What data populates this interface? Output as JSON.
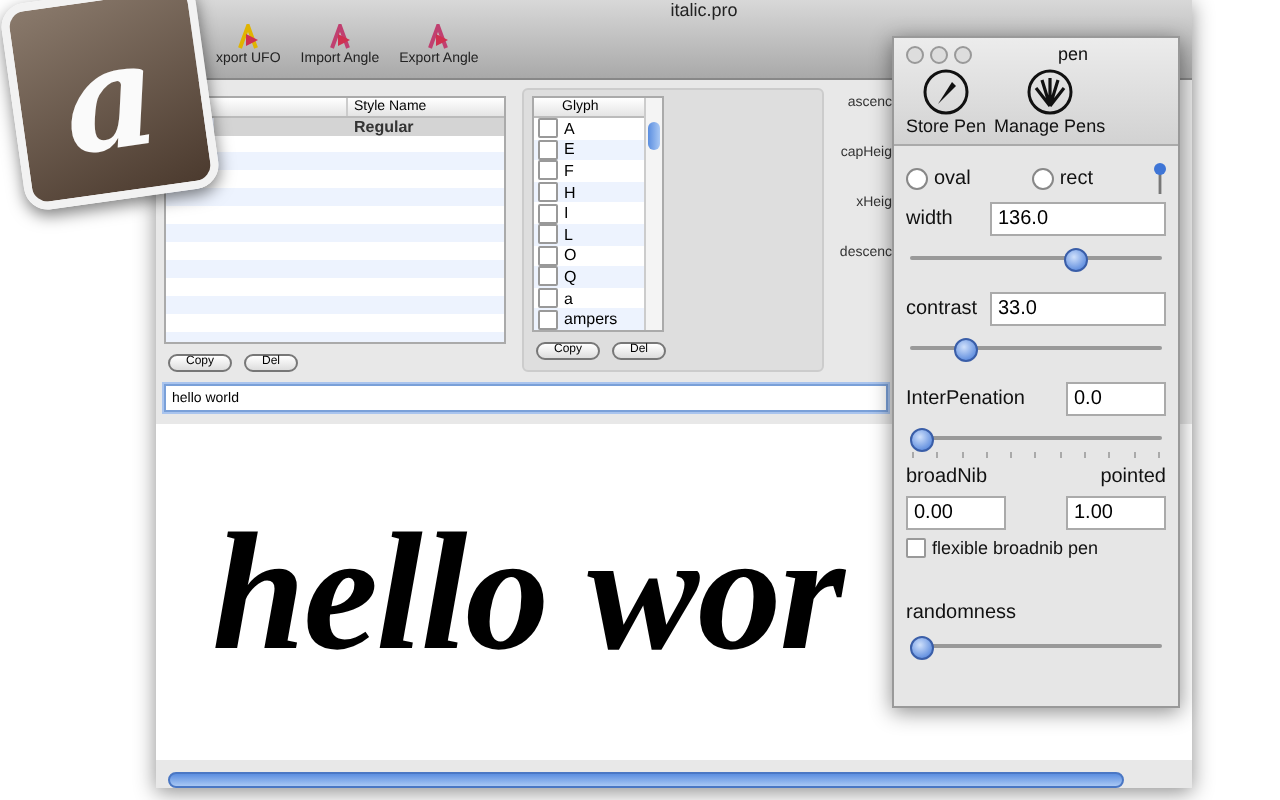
{
  "window": {
    "title": "italic.pro"
  },
  "toolbar": [
    {
      "label": "xport UFO",
      "kind": "ufo"
    },
    {
      "label": "Import Angle",
      "kind": "import"
    },
    {
      "label": "Export Angle",
      "kind": "export"
    }
  ],
  "styles_table": {
    "columns": [
      "Style Name"
    ],
    "rows": [
      {
        "name": "Regular",
        "selected": true
      }
    ],
    "buttons": [
      "Copy",
      "Del"
    ]
  },
  "glyph_list": {
    "columns": [
      "Glyph"
    ],
    "items": [
      {
        "name": "A",
        "checked": false
      },
      {
        "name": "E",
        "checked": false
      },
      {
        "name": "F",
        "checked": false
      },
      {
        "name": "H",
        "checked": false
      },
      {
        "name": "I",
        "checked": false
      },
      {
        "name": "L",
        "checked": false
      },
      {
        "name": "O",
        "checked": false
      },
      {
        "name": "Q",
        "checked": false
      },
      {
        "name": "a",
        "checked": false
      },
      {
        "name": "ampers",
        "checked": false
      }
    ],
    "buttons": [
      "Copy",
      "Del"
    ]
  },
  "metrics": [
    "ascenc",
    "capHeig",
    "xHeig",
    "descenc"
  ],
  "sample_field": {
    "value": "hello world"
  },
  "preview": {
    "text": "hello wor"
  },
  "app_icon": {
    "letter": "a"
  },
  "pen_panel": {
    "title": "pen",
    "tools": [
      {
        "label": "Store Pen",
        "kind": "store"
      },
      {
        "label": "Manage Pens",
        "kind": "manage"
      }
    ],
    "shapes": [
      {
        "label": "oval",
        "selected": false
      },
      {
        "label": "rect",
        "selected": false
      }
    ],
    "width": {
      "label": "width",
      "value": "136.0",
      "level": 0.66
    },
    "contrast": {
      "label": "contrast",
      "value": "33.0",
      "level": 0.19
    },
    "interpenation": {
      "label": "InterPenation",
      "value": "0.0",
      "level": 0
    },
    "broadnib": {
      "label": "broadNib",
      "value": "0.00"
    },
    "pointed": {
      "label": "pointed",
      "value": "1.00"
    },
    "flexible": {
      "label": "flexible broadnib pen",
      "checked": false
    },
    "randomness": {
      "label": "randomness",
      "level": 0
    }
  }
}
